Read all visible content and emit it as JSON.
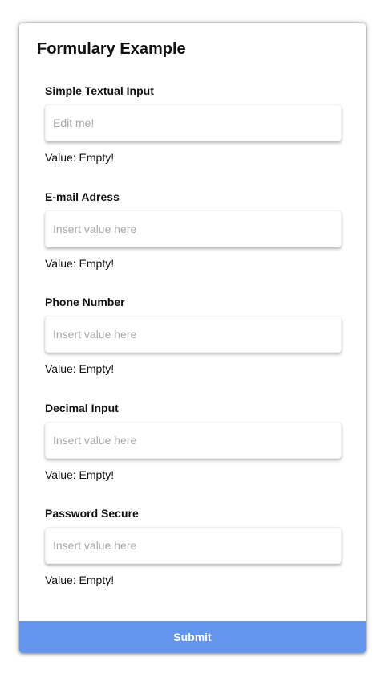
{
  "form": {
    "title": "Formulary Example",
    "fields": [
      {
        "label": "Simple Textual Input",
        "placeholder": "Edit me!",
        "value_text": "Value: Empty!"
      },
      {
        "label": "E-mail Adress",
        "placeholder": "Insert value here",
        "value_text": "Value: Empty!"
      },
      {
        "label": "Phone Number",
        "placeholder": "Insert value here",
        "value_text": "Value: Empty!"
      },
      {
        "label": "Decimal Input",
        "placeholder": "Insert value here",
        "value_text": "Value: Empty!"
      },
      {
        "label": "Password Secure",
        "placeholder": "Insert value here",
        "value_text": "Value: Empty!"
      }
    ],
    "submit_label": "Submit",
    "submit_color": "#6495ed"
  }
}
